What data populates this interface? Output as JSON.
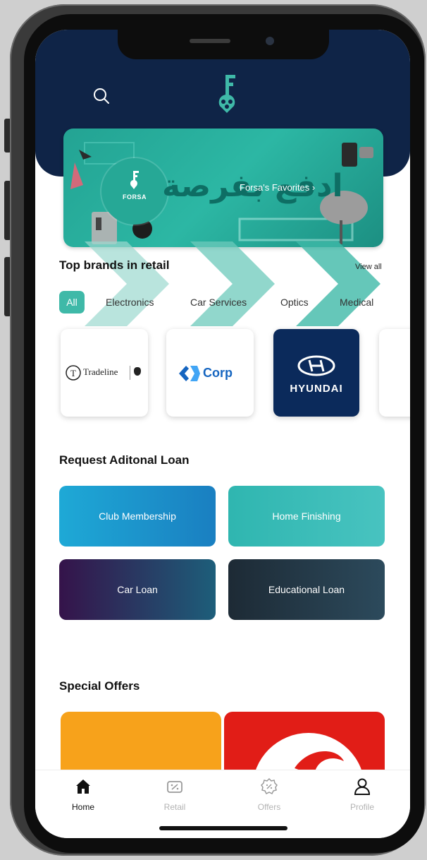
{
  "header": {
    "search_icon": "search-icon",
    "logo_icon": "forsa-key-logo"
  },
  "banner": {
    "brand": "FORSA",
    "arabic_text": "ادفع بفرصة",
    "link_label": "Forsa's Favorites",
    "link_icon": "chevron-right-icon"
  },
  "top_brands": {
    "title": "Top brands in retail",
    "view_all": "View all",
    "filters": [
      "All",
      "Electronics",
      "Car Services",
      "Optics",
      "Medical"
    ],
    "active_filter": "All",
    "brands": [
      {
        "name": "Tradeline"
      },
      {
        "name": "Corp"
      },
      {
        "name": "HYUNDAI"
      }
    ]
  },
  "loans": {
    "title": "Request Aditonal Loan",
    "items": [
      {
        "label": "Club Membership"
      },
      {
        "label": "Home Finishing"
      },
      {
        "label": "Car Loan"
      },
      {
        "label": "Educational Loan"
      }
    ]
  },
  "offers": {
    "title": "Special Offers"
  },
  "nav": {
    "items": [
      {
        "label": "Home",
        "icon": "home-icon",
        "active": true
      },
      {
        "label": "Retail",
        "icon": "retail-tag-icon",
        "active": false
      },
      {
        "label": "Offers",
        "icon": "offers-badge-icon",
        "active": false
      },
      {
        "label": "Profile",
        "icon": "profile-icon",
        "active": false
      }
    ]
  },
  "colors": {
    "header_bg": "#0f2447",
    "accent_teal": "#3fb9a8",
    "text_dark": "#111111"
  }
}
